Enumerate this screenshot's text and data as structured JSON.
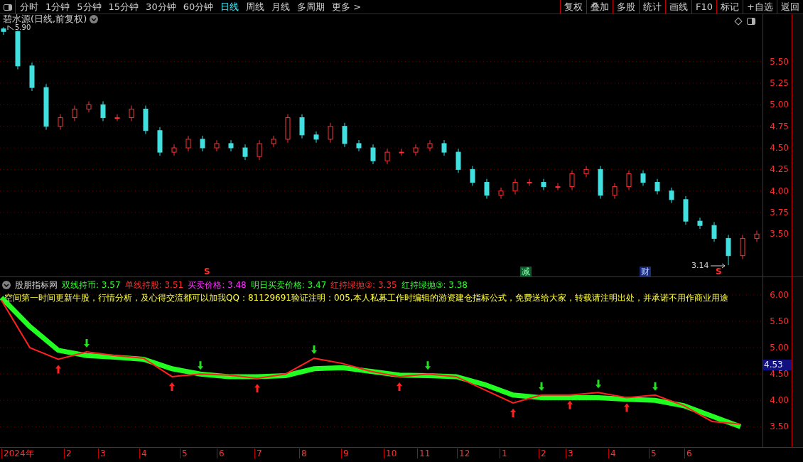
{
  "toolbar": {
    "periods": [
      {
        "label": "分时",
        "selected": false
      },
      {
        "label": "1分钟",
        "selected": false
      },
      {
        "label": "5分钟",
        "selected": false
      },
      {
        "label": "15分钟",
        "selected": false
      },
      {
        "label": "30分钟",
        "selected": false
      },
      {
        "label": "60分钟",
        "selected": false
      },
      {
        "label": "日线",
        "selected": true
      },
      {
        "label": "周线",
        "selected": false
      },
      {
        "label": "月线",
        "selected": false
      },
      {
        "label": "多周期",
        "selected": false
      },
      {
        "label": "更多 >",
        "selected": false
      }
    ],
    "actions": [
      "复权",
      "叠加",
      "多股",
      "统计",
      "画线",
      "F10",
      "标记",
      "+自选",
      "返回"
    ]
  },
  "main_chart": {
    "title": "碧水源(日线,前复权)",
    "high_label": "5.90",
    "low_label": "3.14",
    "signals": [
      {
        "label": "S",
        "kind": "sell"
      },
      {
        "label": "减",
        "kind": "reduce"
      },
      {
        "label": "财",
        "kind": "finance"
      },
      {
        "label": "S",
        "kind": "sell"
      }
    ],
    "chart_data": {
      "type": "candlestick",
      "grid": true,
      "ylim": [
        3.0,
        6.05
      ],
      "yticks": [
        {
          "value": 3.5,
          "label": "3.50"
        },
        {
          "value": 3.75,
          "label": "3.75"
        },
        {
          "value": 4.0,
          "label": "4.00"
        },
        {
          "value": 4.25,
          "label": "4.25"
        },
        {
          "value": 4.5,
          "label": "4.50"
        },
        {
          "value": 4.75,
          "label": "4.75"
        },
        {
          "value": 5.0,
          "label": "5.00"
        },
        {
          "value": 5.25,
          "label": "5.25"
        },
        {
          "value": 5.5,
          "label": "5.50"
        }
      ],
      "ohlc": [
        [
          5.88,
          5.9,
          5.81,
          5.85
        ],
        [
          5.85,
          5.86,
          5.41,
          5.45
        ],
        [
          5.45,
          5.49,
          5.16,
          5.2
        ],
        [
          5.2,
          5.24,
          4.71,
          4.75
        ],
        [
          4.75,
          4.89,
          4.71,
          4.85
        ],
        [
          4.85,
          4.99,
          4.81,
          4.95
        ],
        [
          4.95,
          5.04,
          4.91,
          5.0
        ],
        [
          5.0,
          5.04,
          4.81,
          4.85
        ],
        [
          4.85,
          4.89,
          4.81,
          4.85
        ],
        [
          4.85,
          4.99,
          4.81,
          4.95
        ],
        [
          4.95,
          4.99,
          4.66,
          4.7
        ],
        [
          4.7,
          4.74,
          4.41,
          4.45
        ],
        [
          4.45,
          4.54,
          4.41,
          4.5
        ],
        [
          4.5,
          4.64,
          4.46,
          4.6
        ],
        [
          4.6,
          4.64,
          4.46,
          4.5
        ],
        [
          4.5,
          4.59,
          4.46,
          4.55
        ],
        [
          4.55,
          4.59,
          4.46,
          4.5
        ],
        [
          4.5,
          4.54,
          4.36,
          4.4
        ],
        [
          4.4,
          4.59,
          4.36,
          4.55
        ],
        [
          4.55,
          4.64,
          4.51,
          4.6
        ],
        [
          4.6,
          4.89,
          4.56,
          4.85
        ],
        [
          4.85,
          4.89,
          4.61,
          4.65
        ],
        [
          4.65,
          4.69,
          4.56,
          4.6
        ],
        [
          4.6,
          4.79,
          4.56,
          4.75
        ],
        [
          4.75,
          4.79,
          4.51,
          4.55
        ],
        [
          4.55,
          4.59,
          4.46,
          4.5
        ],
        [
          4.5,
          4.54,
          4.31,
          4.35
        ],
        [
          4.35,
          4.49,
          4.31,
          4.45
        ],
        [
          4.45,
          4.49,
          4.41,
          4.45
        ],
        [
          4.45,
          4.54,
          4.41,
          4.5
        ],
        [
          4.5,
          4.59,
          4.46,
          4.55
        ],
        [
          4.55,
          4.59,
          4.41,
          4.45
        ],
        [
          4.45,
          4.49,
          4.21,
          4.25
        ],
        [
          4.25,
          4.29,
          4.06,
          4.1
        ],
        [
          4.1,
          4.14,
          3.91,
          3.95
        ],
        [
          3.95,
          4.04,
          3.91,
          4.0
        ],
        [
          4.0,
          4.14,
          3.96,
          4.1
        ],
        [
          4.1,
          4.14,
          4.06,
          4.1
        ],
        [
          4.1,
          4.14,
          4.01,
          4.05
        ],
        [
          4.05,
          4.09,
          4.01,
          4.05
        ],
        [
          4.05,
          4.24,
          4.01,
          4.2
        ],
        [
          4.2,
          4.29,
          4.16,
          4.25
        ],
        [
          4.25,
          4.29,
          3.91,
          3.95
        ],
        [
          3.95,
          4.09,
          3.91,
          4.05
        ],
        [
          4.05,
          4.24,
          4.01,
          4.2
        ],
        [
          4.2,
          4.24,
          4.06,
          4.1
        ],
        [
          4.1,
          4.14,
          3.96,
          4.0
        ],
        [
          4.0,
          4.04,
          3.86,
          3.9
        ],
        [
          3.9,
          3.94,
          3.61,
          3.65
        ],
        [
          3.65,
          3.69,
          3.56,
          3.6
        ],
        [
          3.6,
          3.64,
          3.41,
          3.45
        ],
        [
          3.45,
          3.49,
          3.14,
          3.25
        ],
        [
          3.25,
          3.49,
          3.21,
          3.45
        ],
        [
          3.45,
          3.54,
          3.41,
          3.5
        ]
      ]
    }
  },
  "time_axis": [
    "2024年",
    "2",
    "3",
    "4",
    "5",
    "6",
    "7",
    "8",
    "9",
    "10",
    "11",
    "12",
    "1",
    "2",
    "3",
    "4",
    "5",
    "6"
  ],
  "indicator": {
    "name": "股朋指标网",
    "legend": [
      {
        "label": "双线持币: 3.57",
        "color": "#32ff32"
      },
      {
        "label": "单线持股: 3.51",
        "color": "#ff3232"
      },
      {
        "label": "买卖价格: 3.48",
        "color": "#ff32ff"
      },
      {
        "label": "明日买卖价格: 3.47",
        "color": "#32ff32"
      },
      {
        "label": "红持绿抛②: 3.35",
        "color": "#ff3232"
      },
      {
        "label": "红持绿抛③: 3.38",
        "color": "#32ff32"
      }
    ],
    "notice": "空间第一时间更新牛股，行情分析，及心得交流都可以加我QQ：81129691验证注明：005,本人私募工作时编辑的游资建仓指标公式，免费送给大家，转载请注明出处，并承诺不用作商业用途",
    "current_value": "4.53",
    "chart_data": {
      "type": "line",
      "grid": true,
      "ylim": [
        3.1,
        6.31
      ],
      "yticks": [
        {
          "value": 3.5,
          "label": "3.50"
        },
        {
          "value": 4.0,
          "label": "4.00"
        },
        {
          "value": 4.5,
          "label": "4.50"
        },
        {
          "value": 5.0,
          "label": "5.00"
        },
        {
          "value": 5.5,
          "label": "5.50"
        },
        {
          "value": 6.0,
          "label": "6.00"
        }
      ],
      "series": [
        {
          "color": "#ff2020",
          "values": [
            5.9,
            5.0,
            4.78,
            4.92,
            4.85,
            4.8,
            4.45,
            4.5,
            4.48,
            4.42,
            4.5,
            4.8,
            4.7,
            4.55,
            4.45,
            4.5,
            4.45,
            4.2,
            3.95,
            4.1,
            4.1,
            4.15,
            4.05,
            4.1,
            3.9,
            3.6,
            3.55
          ]
        },
        {
          "color": "#20ff20",
          "values": [
            5.95,
            5.4,
            4.95,
            4.85,
            4.82,
            4.78,
            4.6,
            4.5,
            4.45,
            4.45,
            4.47,
            4.6,
            4.62,
            4.55,
            4.48,
            4.47,
            4.45,
            4.3,
            4.1,
            4.05,
            4.05,
            4.05,
            4.02,
            4.0,
            3.9,
            3.7,
            3.5
          ]
        }
      ]
    }
  }
}
